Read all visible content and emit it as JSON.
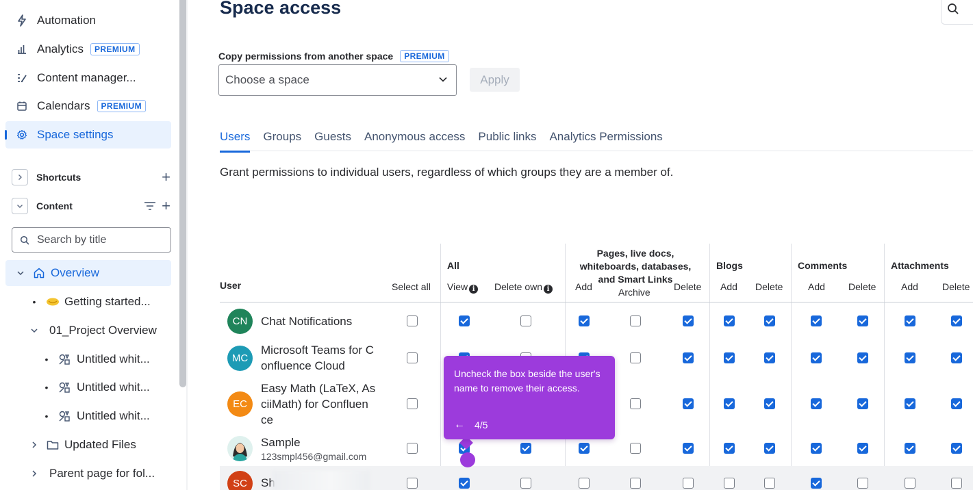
{
  "sidebar": {
    "nav": [
      {
        "label": "Automation",
        "icon": "lightning-icon",
        "badge": ""
      },
      {
        "label": "Analytics",
        "icon": "bar-chart-icon",
        "badge": "PREMIUM"
      },
      {
        "label": "Content manager...",
        "icon": "content-manager-icon",
        "badge": ""
      },
      {
        "label": "Calendars",
        "icon": "calendar-icon",
        "badge": "PREMIUM"
      },
      {
        "label": "Space settings",
        "icon": "gear-icon",
        "badge": "",
        "active": true
      }
    ],
    "shortcuts_label": "Shortcuts",
    "content_label": "Content",
    "search_placeholder": "Search by title",
    "tree": [
      {
        "label": "Overview"
      },
      {
        "label": "Getting started..."
      },
      {
        "label": "01_Project Overview"
      },
      {
        "label": "Untitled whit..."
      },
      {
        "label": "Untitled whit..."
      },
      {
        "label": "Untitled whit..."
      },
      {
        "label": "Updated Files"
      },
      {
        "label": "Parent page for fol..."
      }
    ]
  },
  "main": {
    "title": "Space access",
    "copy_label": "Copy permissions from another space",
    "copy_badge": "PREMIUM",
    "select_placeholder": "Choose a space",
    "apply_label": "Apply",
    "tabs": [
      "Users",
      "Groups",
      "Guests",
      "Anonymous access",
      "Public links",
      "Analytics Permissions"
    ],
    "active_tab": "Users",
    "tab_description": "Grant permissions to individual users, regardless of which groups they are a member of."
  },
  "table": {
    "headers": {
      "user": "User",
      "select_all": "Select all",
      "all_group": "All",
      "view": "View",
      "delete_own": "Delete own",
      "pages_group": "Pages, live docs, whiteboards, databases, and Smart Links",
      "pages_add": "Add",
      "pages_archive": "Archive",
      "pages_delete": "Delete",
      "blogs_group": "Blogs",
      "blogs_add": "Add",
      "blogs_delete": "Delete",
      "comments_group": "Comments",
      "comments_add": "Add",
      "comments_delete": "Delete",
      "attachments_group": "Attachments",
      "attachments_add": "Add",
      "attachments_delete": "Delete"
    },
    "rows": [
      {
        "initials": "CN",
        "avatar_color": "#1f845a",
        "name": "Chat Notifications",
        "email": "",
        "checks": [
          false,
          true,
          false,
          true,
          false,
          true,
          true,
          true,
          true,
          true,
          true,
          true
        ]
      },
      {
        "initials": "MC",
        "avatar_color": "#1d9bb5",
        "name": "Microsoft Teams for C onfluence Cloud",
        "email": "",
        "checks": [
          false,
          true,
          false,
          true,
          false,
          true,
          true,
          true,
          true,
          true,
          true,
          true
        ]
      },
      {
        "initials": "EC",
        "avatar_color": "#f38a14",
        "name": "Easy Math (LaTeX, As ciiMath) for Confluen ce",
        "email": "",
        "checks": [
          false,
          true,
          false,
          true,
          false,
          true,
          true,
          true,
          true,
          true,
          true,
          true
        ]
      },
      {
        "initials": "",
        "avatar_color": "#2aa6a0",
        "name": "Sample",
        "email": "123smpl456@gmail.com",
        "checks": [
          false,
          true,
          true,
          true,
          false,
          true,
          true,
          true,
          true,
          true,
          true,
          true
        ]
      },
      {
        "initials": "SC",
        "avatar_color": "#d14015",
        "name": "Sh",
        "email": "",
        "checks": [
          false,
          true,
          false,
          false,
          false,
          false,
          false,
          false,
          true,
          false,
          false,
          false
        ]
      }
    ]
  },
  "tooltip": {
    "text": "Uncheck the box beside the user's name to remove their access.",
    "step": "4/5",
    "back_arrow": "←"
  },
  "colors": {
    "accent": "#1868db",
    "tooltip": "#9c3bdc"
  }
}
